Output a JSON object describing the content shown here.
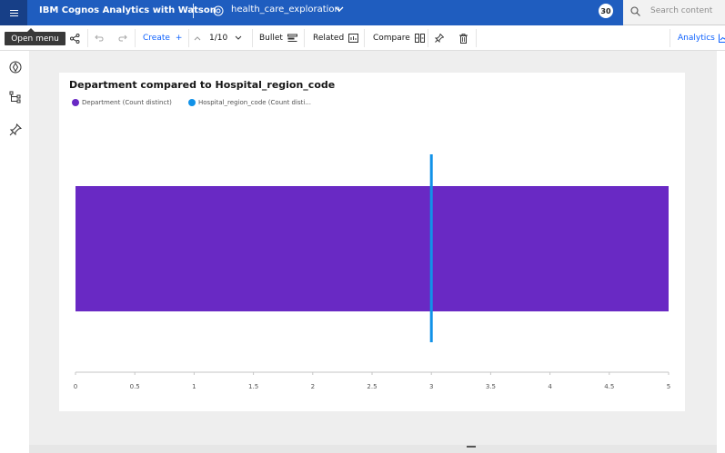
{
  "header": {
    "app_title": "IBM Cognos Analytics with Watson",
    "exploration_name": "health_care_exploration",
    "avatar_text": "30",
    "search_placeholder": "Search content",
    "brand_color": "#1f5dbf"
  },
  "tooltip": {
    "text": "Open menu"
  },
  "toolbar": {
    "create_label": "Create",
    "create_plus": "+",
    "page_indicator": "1/10",
    "bullet_label": "Bullet",
    "related_label": "Related",
    "compare_label": "Compare",
    "analytics_label": "Analytics"
  },
  "icons": {
    "menu": "hamburger-menu-icon",
    "explore": "exploration-icon",
    "share": "share-icon",
    "undo": "undo-icon",
    "redo": "redo-icon",
    "pin": "pin-icon",
    "delete": "trash-icon",
    "left_nav": [
      "navigation-icon",
      "hierarchy-icon",
      "pin-icon"
    ]
  },
  "chart_data": {
    "type": "bar",
    "orientation": "horizontal",
    "subtype": "bullet",
    "title": "Department compared to Hospital_region_code",
    "series": [
      {
        "name": "Department (Count distinct)",
        "values": [
          5
        ],
        "color": "#6929c4"
      },
      {
        "name": "Hospital_region_code (Count disti...",
        "values": [
          3
        ],
        "color": "#1192e8",
        "mark": "target-line"
      }
    ],
    "xlim": [
      0,
      5
    ],
    "x_ticks": [
      "0",
      "0.5",
      "1",
      "1.5",
      "2",
      "2.5",
      "3",
      "3.5",
      "4",
      "4.5",
      "5"
    ],
    "x_tick_values": [
      0,
      0.5,
      1,
      1.5,
      2,
      2.5,
      3,
      3.5,
      4,
      4.5,
      5
    ],
    "grid": false,
    "legend_position": "top-left"
  }
}
